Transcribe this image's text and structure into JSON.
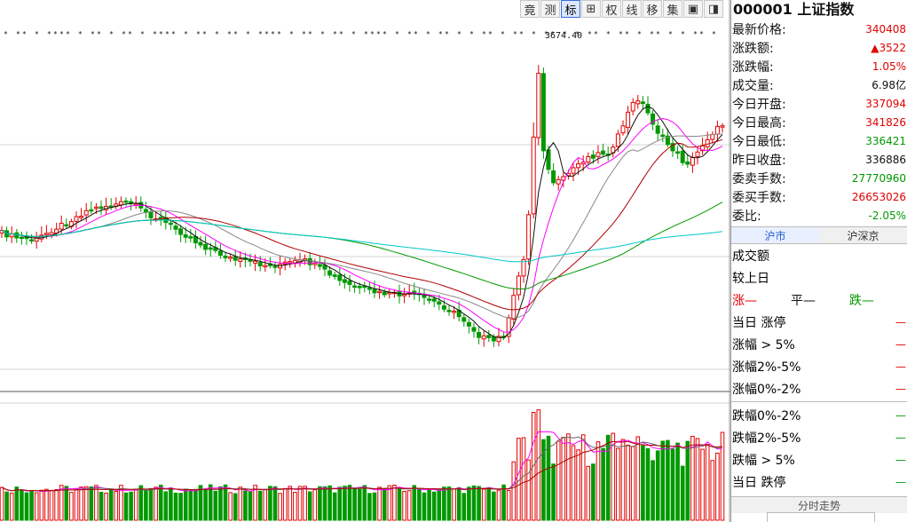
{
  "toolbar": {
    "buttons": [
      "竟",
      "测",
      "标",
      "⊞",
      "权",
      "线",
      "移",
      "集",
      "▣",
      "◨"
    ],
    "active_index": 2
  },
  "chart": {
    "peak_label": "3674.40"
  },
  "quote": {
    "title": "000001 上证指数",
    "rows": [
      {
        "label": "最新价格:",
        "value": "340408",
        "color": "up"
      },
      {
        "label": "涨跌额:",
        "value": "▲3522",
        "color": "up"
      },
      {
        "label": "涨跌幅:",
        "value": "1.05%",
        "color": "up"
      },
      {
        "label": "成交量:",
        "value": "6.98亿",
        "color": "flat"
      },
      {
        "label": "今日开盘:",
        "value": "337094",
        "color": "up"
      },
      {
        "label": "今日最高:",
        "value": "341826",
        "color": "up"
      },
      {
        "label": "今日最低:",
        "value": "336421",
        "color": "down"
      },
      {
        "label": "昨日收盘:",
        "value": "336886",
        "color": "flat"
      },
      {
        "label": "委卖手数:",
        "value": "27770960",
        "color": "down"
      },
      {
        "label": "委买手数:",
        "value": "26653026",
        "color": "up"
      },
      {
        "label": "委比:",
        "value": "-2.05%",
        "color": "down"
      }
    ]
  },
  "tabs": [
    "沪市",
    "沪深京"
  ],
  "breadth": {
    "turnover_label": "成交额",
    "compare_label": "较上日",
    "rise": "涨—",
    "flat": "平—",
    "fall": "跌—",
    "up_rows": [
      "当日 涨停",
      "涨幅 > 5%",
      "涨幅2%-5%",
      "涨幅0%-2%"
    ],
    "down_rows": [
      "跌幅0%-2%",
      "跌幅2%-5%",
      "跌幅 > 5%",
      "当日 跌停"
    ],
    "dash": "—"
  },
  "bottom_tab": "分时走势",
  "colors": {
    "up": "#e00000",
    "down": "#009900",
    "ma5": "#111111",
    "ma10": "#ff00ff",
    "ma20": "#888888",
    "ma30": "#b00000",
    "ma60": "#009900",
    "ma120": "#00c8c8"
  }
}
